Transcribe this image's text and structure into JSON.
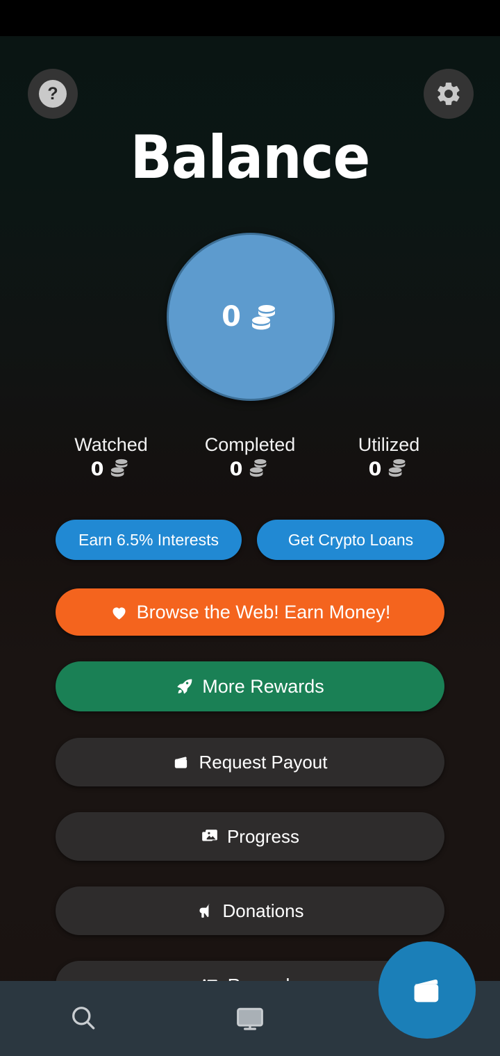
{
  "header": {
    "title": "Balance",
    "help_icon": "question-mark-icon",
    "settings_icon": "gear-icon"
  },
  "balance": {
    "amount": "0",
    "currency_icon": "coins-icon",
    "circle_color": "#5d9bce"
  },
  "stats": [
    {
      "label": "Watched",
      "value": "0",
      "icon": "coins-icon"
    },
    {
      "label": "Completed",
      "value": "0",
      "icon": "coins-icon"
    },
    {
      "label": "Utilized",
      "value": "0",
      "icon": "coins-icon"
    }
  ],
  "actions": {
    "interests": {
      "label": "Earn 6.5% Interests",
      "color": "#2189d3"
    },
    "loans": {
      "label": "Get Crypto Loans",
      "color": "#2189d3"
    },
    "browse": {
      "label": "Browse the Web! Earn Money!",
      "icon": "heart-icon",
      "color": "#f4641e"
    },
    "more_rewards": {
      "label": "More Rewards",
      "icon": "rocket-icon",
      "color": "#1a8055"
    },
    "payout": {
      "label": "Request Payout",
      "icon": "wallet-icon",
      "color": "#2e2c2c"
    },
    "progress": {
      "label": "Progress",
      "icon": "images-icon",
      "color": "#2e2c2c"
    },
    "donations": {
      "label": "Donations",
      "icon": "megaphone-icon",
      "color": "#2e2c2c"
    },
    "rewards": {
      "label": "Rewards",
      "icon": "list-icon",
      "color": "#2e2c2c"
    }
  },
  "bottom_nav": {
    "background": "#2b3740",
    "items": [
      {
        "name": "search",
        "icon": "search-icon"
      },
      {
        "name": "monitor",
        "icon": "monitor-icon"
      }
    ],
    "fab": {
      "icon": "wallet-icon",
      "color": "#1b7fb8"
    }
  }
}
